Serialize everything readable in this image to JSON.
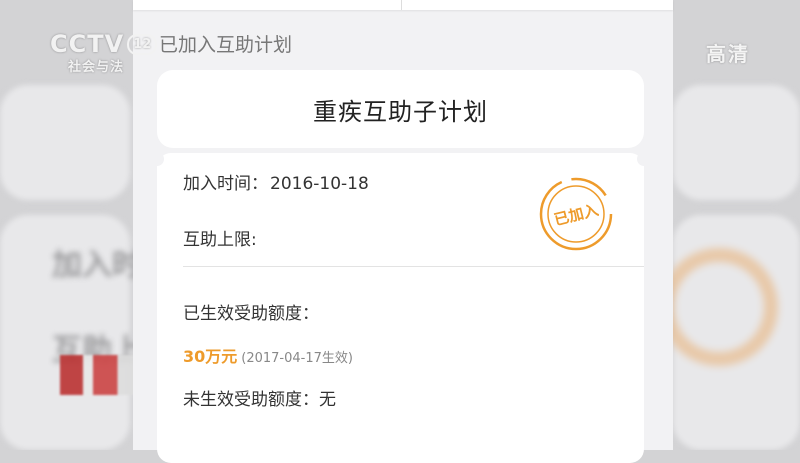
{
  "watermark": {
    "channel_logo": "CCTV",
    "channel_number": "12",
    "channel_subtitle": "社会与法",
    "quality": "高清"
  },
  "background_blur": {
    "text_1": "加入时",
    "text_2": "互助上"
  },
  "section_title": "已加入互助计划",
  "plan": {
    "name": "重疾互助子计划"
  },
  "details": {
    "join_time_label": "加入时间：",
    "join_time_value": "2016-10-18",
    "limit_label": "互助上限:",
    "limit_value": "",
    "effective_label": "已生效受助额度：",
    "effective_amount": "30万元",
    "effective_note": "(2017-04-17生效)",
    "not_effective_label": "未生效受助额度：",
    "not_effective_value": "无"
  },
  "stamp": {
    "text": "已加入",
    "color": "#ee9b2b"
  },
  "colors": {
    "accent": "#ee9b2b",
    "card": "#ffffff",
    "page_bg": "#f2f2f4"
  }
}
